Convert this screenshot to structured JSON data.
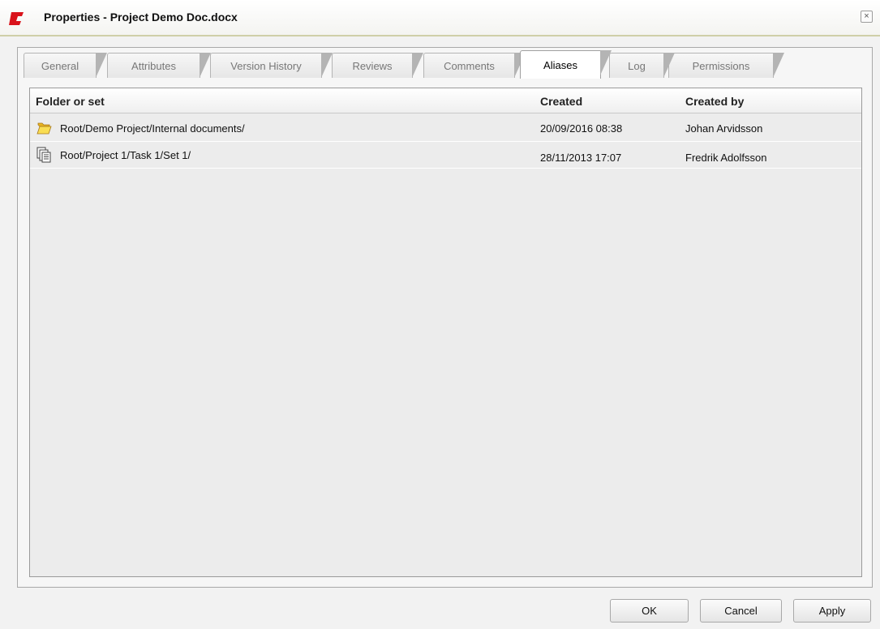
{
  "window": {
    "title": "Properties - Project Demo Doc.docx",
    "close_glyph": "×",
    "logo_icon": "app-logo-icon",
    "accent_color": "#d9131b"
  },
  "tabs": [
    {
      "label": "General",
      "active": false
    },
    {
      "label": "Attributes",
      "active": false
    },
    {
      "label": "Version History",
      "active": false
    },
    {
      "label": "Reviews",
      "active": false
    },
    {
      "label": "Comments",
      "active": false
    },
    {
      "label": "Aliases",
      "active": true
    },
    {
      "label": "Log",
      "active": false
    },
    {
      "label": "Permissions",
      "active": false
    }
  ],
  "grid": {
    "columns": [
      "Folder or set",
      "Created",
      "Created by"
    ],
    "rows": [
      {
        "icon": "folder-icon",
        "folder": "Root/Demo Project/Internal documents/",
        "created": "20/09/2016 08:38",
        "created_by": "Johan Arvidsson"
      },
      {
        "icon": "set-icon",
        "folder": "Root/Project 1/Task 1/Set 1/",
        "created": "28/11/2013 17:07",
        "created_by": "Fredrik Adolfsson"
      }
    ]
  },
  "buttons": {
    "ok": "OK",
    "cancel": "Cancel",
    "apply": "Apply"
  }
}
